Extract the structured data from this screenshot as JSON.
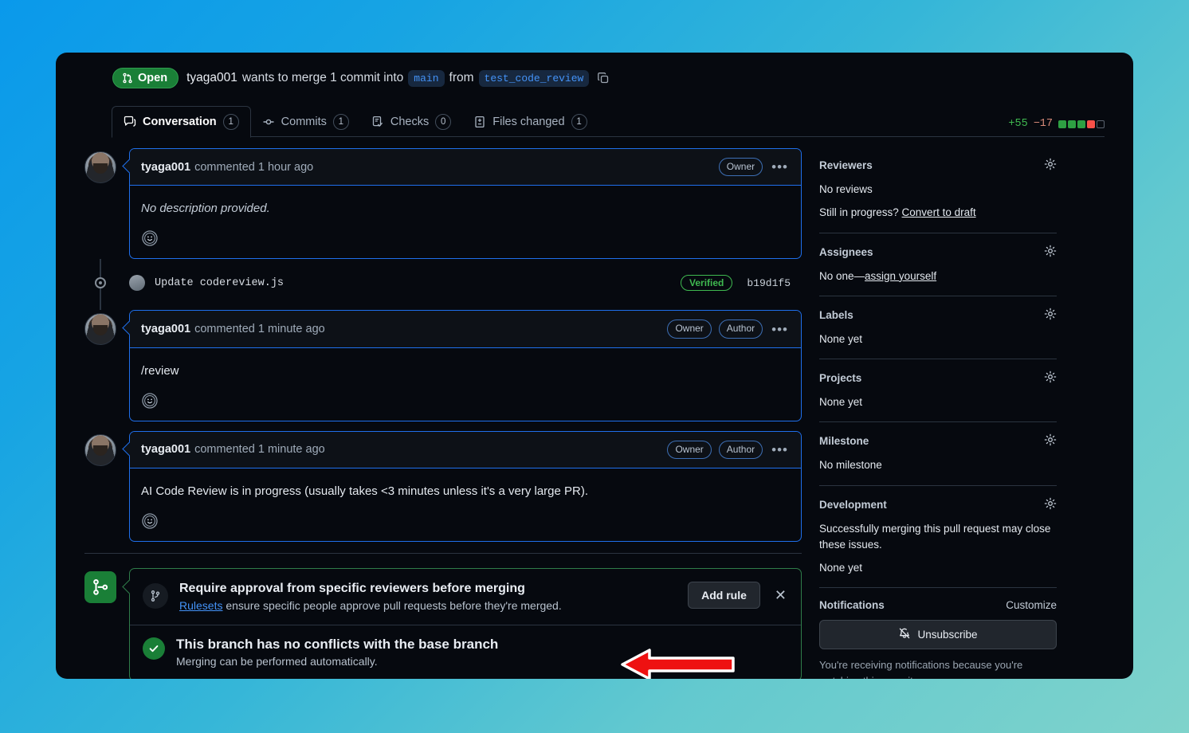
{
  "header": {
    "state_label": "Open",
    "state_icon": "pull-request-icon",
    "author": "tyaga001",
    "action_text": "wants to merge 1 commit into",
    "base_branch": "main",
    "from_text": "from",
    "head_branch": "test_code_review",
    "copy_icon": "copy-icon",
    "state_color": "#1a7f37"
  },
  "tabs": [
    {
      "label": "Conversation",
      "count": "1",
      "icon": "comment-icon",
      "active": true
    },
    {
      "label": "Commits",
      "count": "1",
      "icon": "commit-icon",
      "active": false
    },
    {
      "label": "Checks",
      "count": "0",
      "icon": "checklist-icon",
      "active": false
    },
    {
      "label": "Files changed",
      "count": "1",
      "icon": "file-diff-icon",
      "active": false
    }
  ],
  "diffstat": {
    "additions": "+55",
    "deletions": "−17",
    "blocks": [
      "add",
      "add",
      "add",
      "del",
      "none"
    ],
    "add_color": "#3fb950",
    "del_color": "#f85149"
  },
  "timeline": {
    "comments": [
      {
        "author": "tyaga001",
        "meta": "commented 1 hour ago",
        "badges": [
          "Owner"
        ],
        "body": "No description provided.",
        "italic": true,
        "reaction_icon": "smiley-icon",
        "kebab": "•••"
      },
      {
        "author": "tyaga001",
        "meta": "commented 1 minute ago",
        "badges": [
          "Owner",
          "Author"
        ],
        "body": "/review",
        "italic": false,
        "reaction_icon": "smiley-icon",
        "kebab": "•••"
      },
      {
        "author": "tyaga001",
        "meta": "commented 1 minute ago",
        "badges": [
          "Owner",
          "Author"
        ],
        "body": "AI Code Review is in progress (usually takes <3 minutes unless it's a very large PR).",
        "italic": false,
        "reaction_icon": "smiley-icon",
        "kebab": "•••"
      }
    ],
    "commit": {
      "message": "Update codereview.js",
      "verified_label": "Verified",
      "sha": "b19d1f5"
    }
  },
  "merge_section": {
    "badge_icon": "git-merge-icon",
    "rule": {
      "icon": "git-branch-icon",
      "title": "Require approval from specific reviewers before merging",
      "desc_link": "Rulesets",
      "desc_rest": " ensure specific people approve pull requests before they're merged.",
      "add_rule_label": "Add rule",
      "close_icon": "close-icon"
    },
    "conflict": {
      "icon": "check-icon",
      "title": "This branch has no conflicts with the base branch",
      "subtitle": "Merging can be performed automatically."
    }
  },
  "sidebar": {
    "reviewers": {
      "title": "Reviewers",
      "gear_icon": "gear-icon",
      "value": "No reviews",
      "prompt_prefix": "Still in progress? ",
      "prompt_link": "Convert to draft"
    },
    "assignees": {
      "title": "Assignees",
      "gear_icon": "gear-icon",
      "value_prefix": "No one—",
      "value_link": "assign yourself"
    },
    "labels": {
      "title": "Labels",
      "gear_icon": "gear-icon",
      "value": "None yet"
    },
    "projects": {
      "title": "Projects",
      "gear_icon": "gear-icon",
      "value": "None yet"
    },
    "milestone": {
      "title": "Milestone",
      "gear_icon": "gear-icon",
      "value": "No milestone"
    },
    "development": {
      "title": "Development",
      "gear_icon": "gear-icon",
      "value": "Successfully merging this pull request may close these issues.",
      "value2": "None yet"
    },
    "notifications": {
      "title": "Notifications",
      "customize_label": "Customize",
      "button_label": "Unsubscribe",
      "button_icon": "bell-slash-icon",
      "note": "You're receiving notifications because you're watching this repository."
    }
  },
  "annotation": {
    "arrow_color": "#ee1111",
    "arrow_direction": "left"
  }
}
